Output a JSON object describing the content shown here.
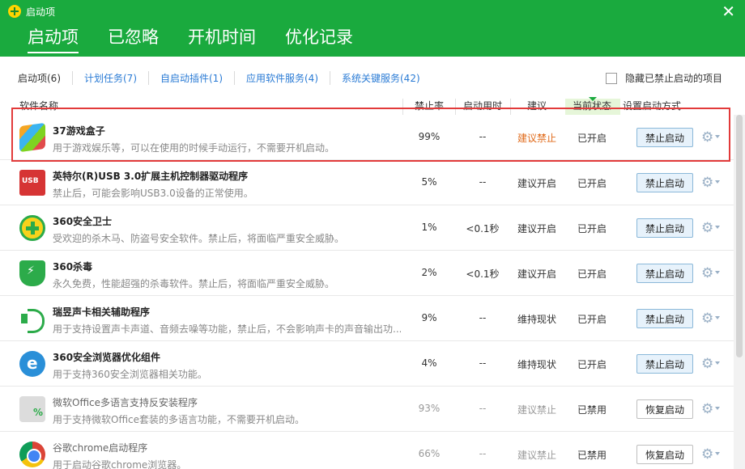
{
  "window": {
    "title": "启动项"
  },
  "tabs": [
    {
      "label": "启动项"
    },
    {
      "label": "已忽略"
    },
    {
      "label": "开机时间"
    },
    {
      "label": "优化记录"
    }
  ],
  "subtabs": [
    {
      "label": "启动项(6)"
    },
    {
      "label": "计划任务(7)"
    },
    {
      "label": "自启动插件(1)"
    },
    {
      "label": "应用软件服务(4)"
    },
    {
      "label": "系统关键服务(42)"
    }
  ],
  "hide_disabled_label": "隐藏已禁止启动的项目",
  "columns": {
    "name": "软件名称",
    "rate": "禁止率",
    "time": "启动用时",
    "advice": "建议",
    "state": "当前状态",
    "action": "设置启动方式"
  },
  "rows": [
    {
      "icon": "game-box-icon",
      "name": "37游戏盒子",
      "desc": "用于游戏娱乐等，可以在使用的时候手动运行，不需要开机启动。",
      "rate": "99%",
      "time": "--",
      "advice": "建议禁止",
      "state": "已开启",
      "action": "禁止启动"
    },
    {
      "icon": "usb-icon",
      "name": "英特尔(R)USB 3.0扩展主机控制器驱动程序",
      "desc": "禁止后，可能会影响USB3.0设备的正常使用。",
      "rate": "5%",
      "time": "--",
      "advice": "建议开启",
      "state": "已开启",
      "action": "禁止启动"
    },
    {
      "icon": "shield-plus-icon",
      "name": "360安全卫士",
      "desc": "受欢迎的杀木马、防盗号安全软件。禁止后，将面临严重安全威胁。",
      "rate": "1%",
      "time": "<0.1秒",
      "advice": "建议开启",
      "state": "已开启",
      "action": "禁止启动"
    },
    {
      "icon": "antivirus-shield-icon",
      "name": "360杀毒",
      "desc": "永久免费，性能超强的杀毒软件。禁止后，将面临严重安全威胁。",
      "rate": "2%",
      "time": "<0.1秒",
      "advice": "建议开启",
      "state": "已开启",
      "action": "禁止启动"
    },
    {
      "icon": "speaker-icon",
      "name": "瑞昱声卡相关辅助程序",
      "desc": "用于支持设置声卡声道、音频去噪等功能，禁止后，不会影响声卡的声音输出功...",
      "rate": "9%",
      "time": "--",
      "advice": "维持现状",
      "state": "已开启",
      "action": "禁止启动"
    },
    {
      "icon": "browser-icon",
      "name": "360安全浏览器优化组件",
      "desc": "用于支持360安全浏览器相关功能。",
      "rate": "4%",
      "time": "--",
      "advice": "维持现状",
      "state": "已开启",
      "action": "禁止启动"
    },
    {
      "icon": "office-installer-icon",
      "name": "微软Office多语言支持反安装程序",
      "desc": "用于支持微软Office套装的多语言功能，不需要开机启动。",
      "rate": "93%",
      "time": "--",
      "advice": "建议禁止",
      "state": "已禁用",
      "action": "恢复启动"
    },
    {
      "icon": "chrome-icon",
      "name": "谷歌chrome启动程序",
      "desc": "用于启动谷歌chrome浏览器。",
      "rate": "66%",
      "time": "--",
      "advice": "建议禁止",
      "state": "已禁用",
      "action": "恢复启动"
    }
  ],
  "colors": {
    "brand_green": "#1aaa3e",
    "highlight_red": "#e23a3a",
    "link_blue": "#2a7bd5",
    "warn_orange": "#e06a1a"
  }
}
